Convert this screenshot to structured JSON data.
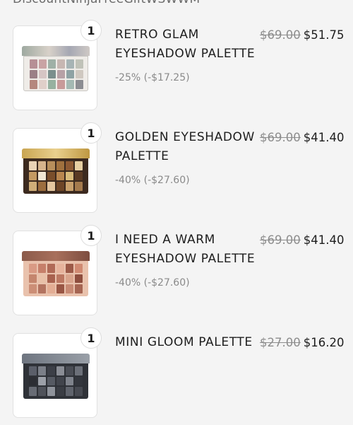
{
  "header_fragment": "DiscountNinjaFreeGiftWSWWM",
  "items": [
    {
      "name": "RETRO GLAM EYESHADOW PALETTE",
      "quantity": "1",
      "original_price": "$69.00",
      "price": "$51.75",
      "discount": "-25% (-$17.25)",
      "swatches": [
        "#b68f95",
        "#c9a3a4",
        "#9fb0a6",
        "#c7b7b2",
        "#a7b4b5",
        "#c0c2b8",
        "#9b7f86",
        "#d6c5c4",
        "#7b8f8d",
        "#b7a1a6",
        "#8ea2a4",
        "#cfc8c0",
        "#b5877e",
        "#e0cfc9",
        "#97b1a0",
        "#c89b9a",
        "#a4b9b3",
        "#8c8d92"
      ]
    },
    {
      "name": "GOLDEN EYESHADOW PALETTE",
      "quantity": "1",
      "original_price": "$69.00",
      "price": "$41.40",
      "discount": "-40% (-$27.60)",
      "swatches": [
        "#e9d3b5",
        "#d5b48c",
        "#b78f5c",
        "#a0713e",
        "#8e5a33",
        "#e7cfa2",
        "#c49a62",
        "#f1e6d3",
        "#7a4e2b",
        "#b9864f",
        "#d8ba7a",
        "#5a3a23",
        "#cfae78",
        "#9c6d3e",
        "#e3c6a0",
        "#6d4527",
        "#c8a06c",
        "#a47a4d"
      ]
    },
    {
      "name": "I NEED A WARM EYESHADOW PALETTE",
      "quantity": "1",
      "original_price": "$69.00",
      "price": "$41.40",
      "discount": "-40% (-$27.60)",
      "swatches": [
        "#d99a84",
        "#c67f6a",
        "#b06a57",
        "#e6b39c",
        "#9c5a48",
        "#d08a72",
        "#c4856d",
        "#e8c0a8",
        "#a8614e",
        "#bc7862",
        "#d9a48c",
        "#8e4e3e",
        "#cc8e76",
        "#b37360",
        "#e3ad94",
        "#995644",
        "#c88a74",
        "#a66552"
      ]
    },
    {
      "name": "MINI GLOOM PALETTE",
      "quantity": "1",
      "original_price": "$27.00",
      "price": "$16.20",
      "discount": "",
      "swatches": [
        "#5b5f6a",
        "#7b7f88",
        "#3c3f47",
        "#8a8d95",
        "#4a4d55",
        "#6c7079",
        "#2c2e34",
        "#9ca0a8",
        "#565a63",
        "#41444c",
        "#7f838c",
        "#33363d",
        "#686c75",
        "#4f525a",
        "#8f939b",
        "#3a3d44",
        "#60646d",
        "#474a52"
      ]
    }
  ]
}
